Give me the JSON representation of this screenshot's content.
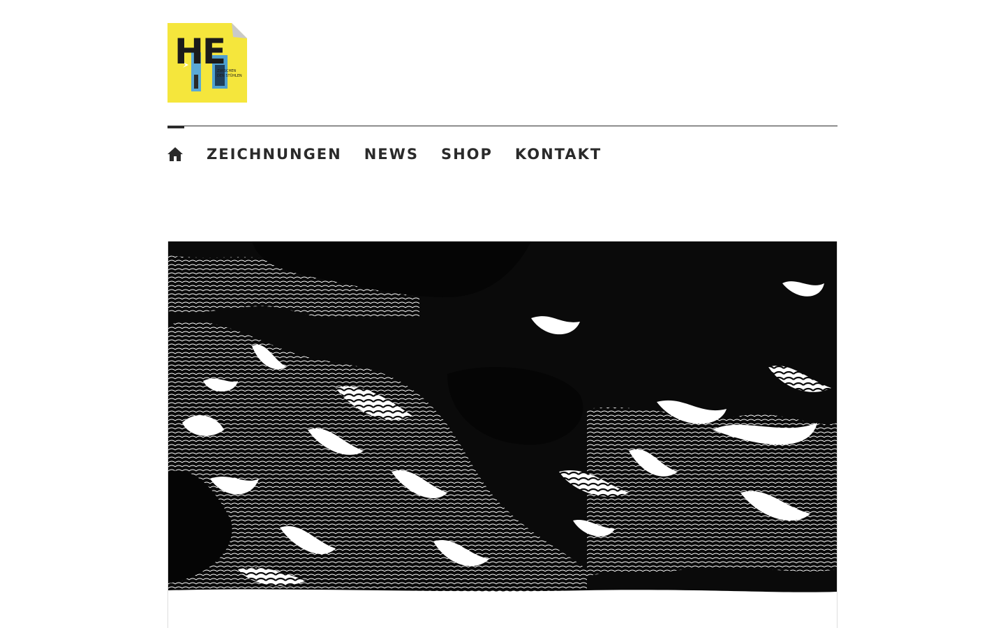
{
  "site": {
    "logo_alt": "HE – Zeichnungen aus dem Stadtleben",
    "logo_lines": [
      "HE",
      "ZWISCHEN",
      "DEN STÜHLEN"
    ]
  },
  "nav": {
    "items": [
      {
        "label": "ZEICHNUNGEN"
      },
      {
        "label": "NEWS"
      },
      {
        "label": "SHOP"
      },
      {
        "label": "KONTAKT"
      }
    ]
  },
  "featured": {
    "image_alt": "Schwarz-weiße Tuschezeichnung einer Landschaft"
  },
  "colors": {
    "logo_background": "#f5e63c",
    "text": "#2a2a2a",
    "rule": "#2b2b2b",
    "ink": "#0a0a0a"
  }
}
